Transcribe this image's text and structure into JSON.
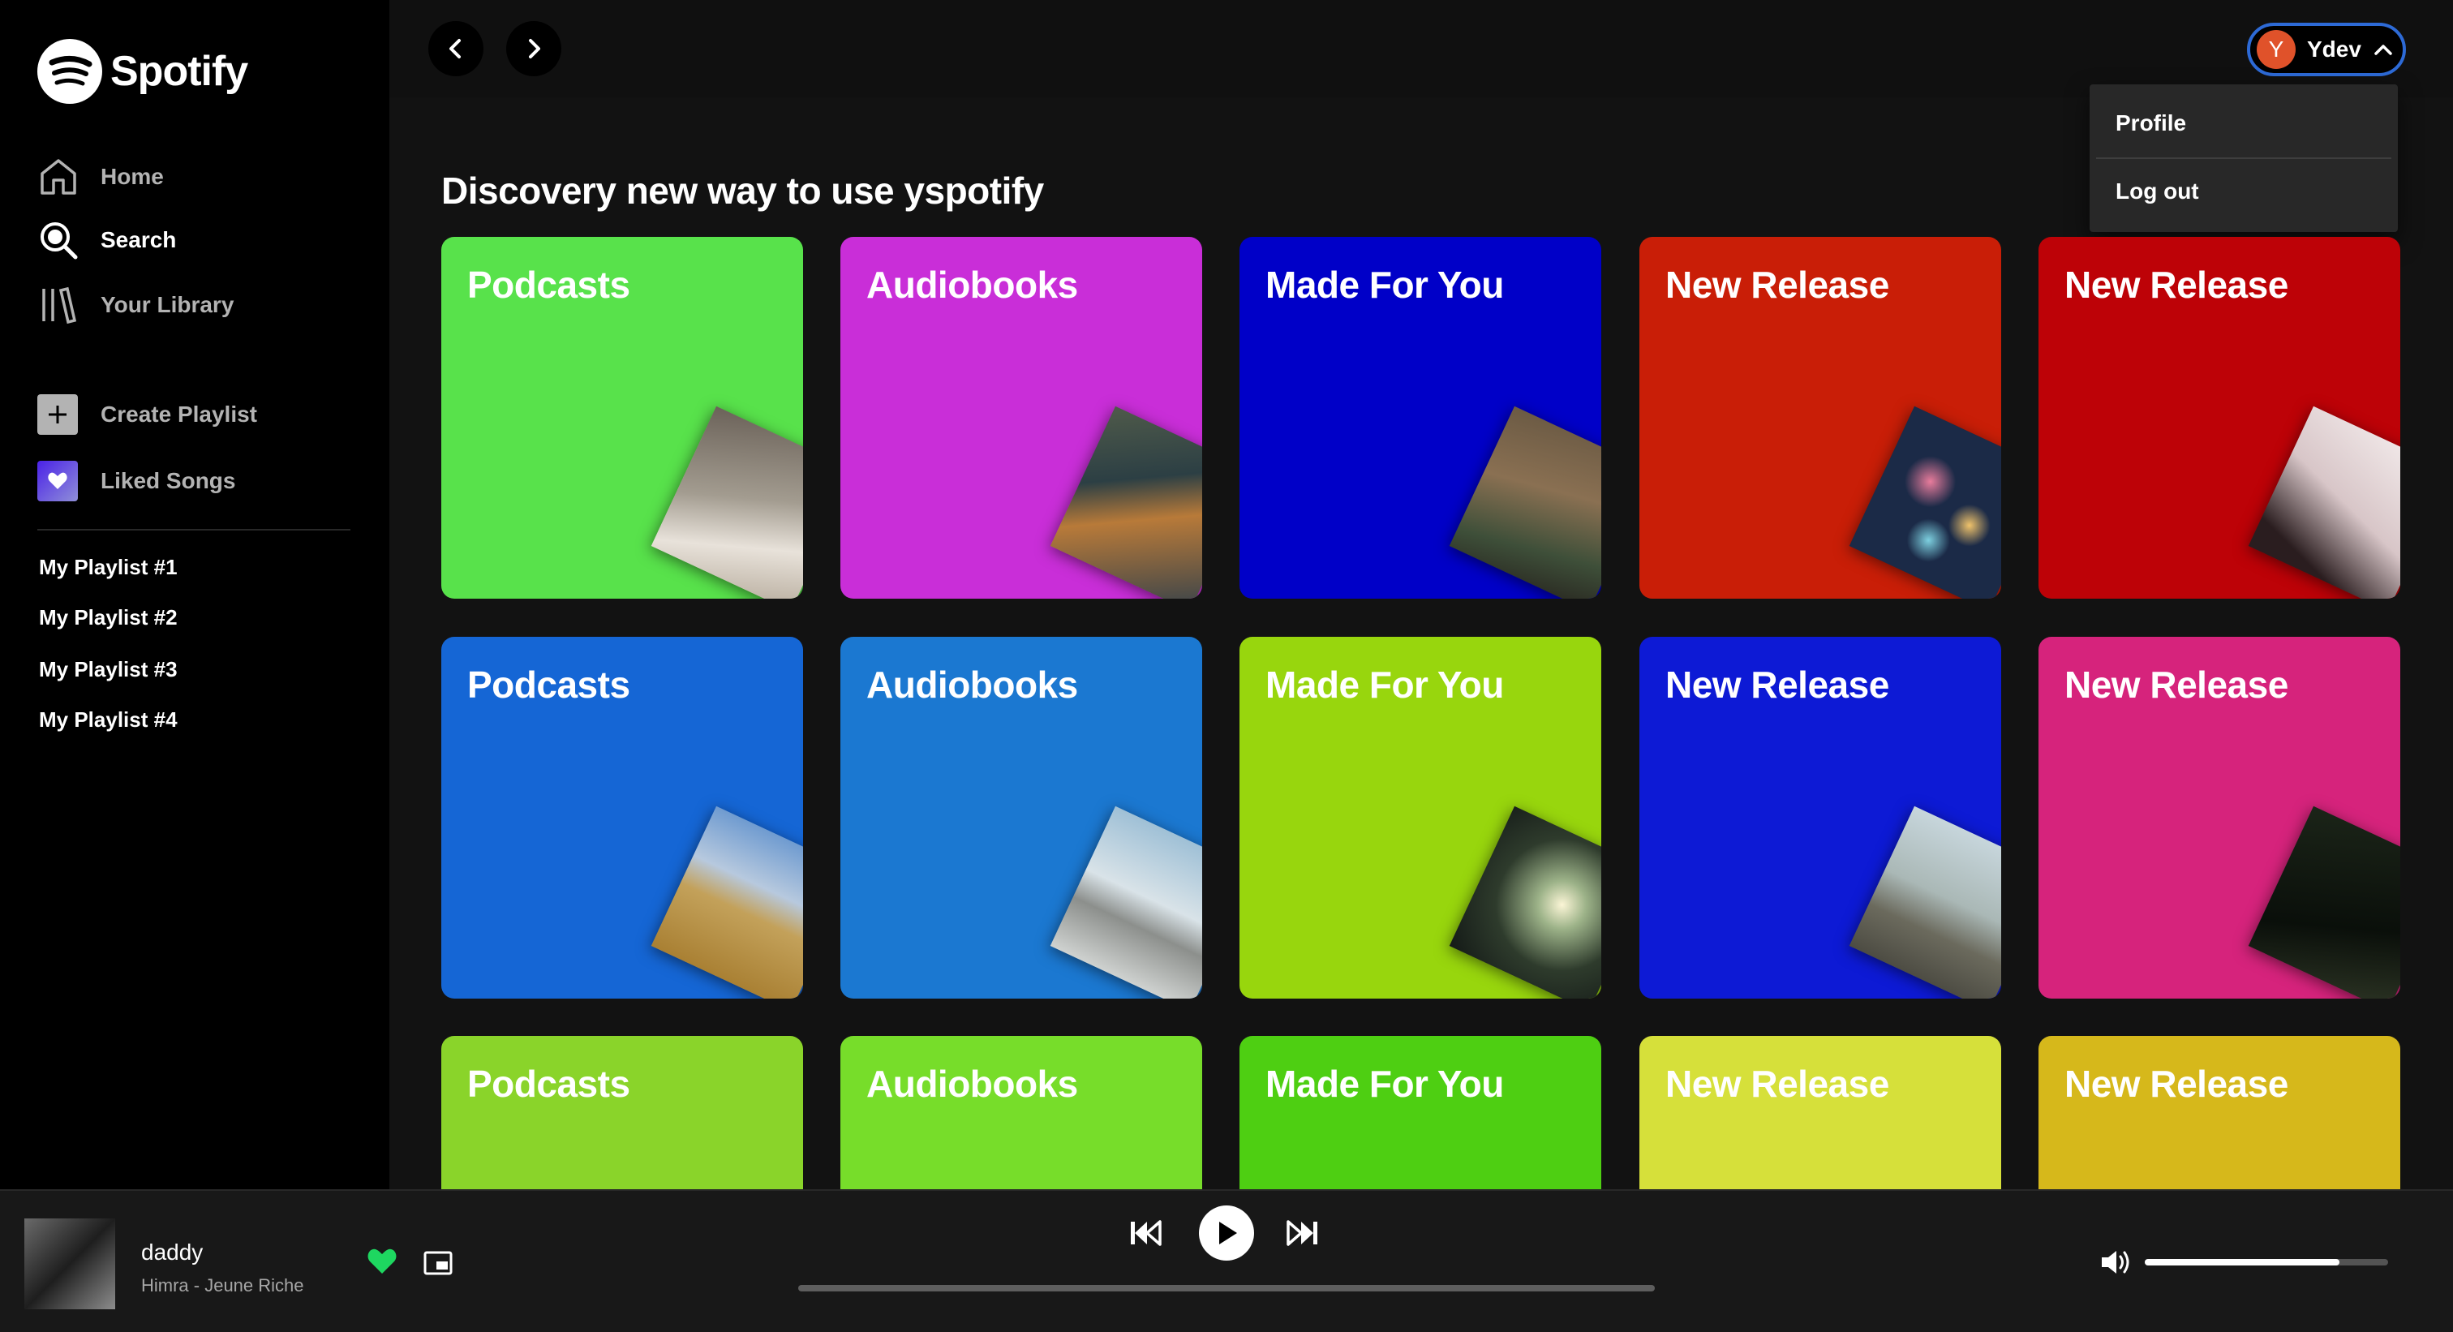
{
  "brand": {
    "name": "Spotify"
  },
  "sidebar": {
    "nav": [
      {
        "label": "Home",
        "icon": "home-icon"
      },
      {
        "label": "Search",
        "icon": "search-icon"
      },
      {
        "label": "Your Library",
        "icon": "library-icon"
      }
    ],
    "actions": [
      {
        "label": "Create Playlist",
        "icon": "plus-icon"
      },
      {
        "label": "Liked Songs",
        "icon": "heart-icon"
      }
    ],
    "playlists": [
      "My Playlist #1",
      "My Playlist #2",
      "My Playlist #3",
      "My Playlist #4"
    ]
  },
  "header": {
    "user": {
      "initial": "Y",
      "name": "Ydev"
    },
    "menu": [
      "Profile",
      "Log out"
    ]
  },
  "main": {
    "heading": "Discovery new way to use yspotify",
    "cards": [
      {
        "title": "Podcasts",
        "color": "#58e24b"
      },
      {
        "title": "Audiobooks",
        "color": "#c92ed8"
      },
      {
        "title": "Made For You",
        "color": "#0000c8"
      },
      {
        "title": "New Release",
        "color": "#c91e07"
      },
      {
        "title": "New Release",
        "color": "#bd0207"
      },
      {
        "title": "Podcasts",
        "color": "#1566d5"
      },
      {
        "title": "Audiobooks",
        "color": "#1b78d1"
      },
      {
        "title": "Made For You",
        "color": "#98d60d"
      },
      {
        "title": "New Release",
        "color": "#0d1ad5"
      },
      {
        "title": "New Release",
        "color": "#d6237c"
      },
      {
        "title": "Podcasts",
        "color": "#8ad42a"
      },
      {
        "title": "Audiobooks",
        "color": "#77dd2a"
      },
      {
        "title": "Made For You",
        "color": "#4ecf12"
      },
      {
        "title": "New Release",
        "color": "#d6e03a"
      },
      {
        "title": "New Release",
        "color": "#d6b81b"
      }
    ]
  },
  "player": {
    "track": "daddy",
    "artist": "Himra - Jeune Riche",
    "liked": true,
    "progress": 0.0,
    "volume": 0.8,
    "accent": "#1ed760"
  }
}
